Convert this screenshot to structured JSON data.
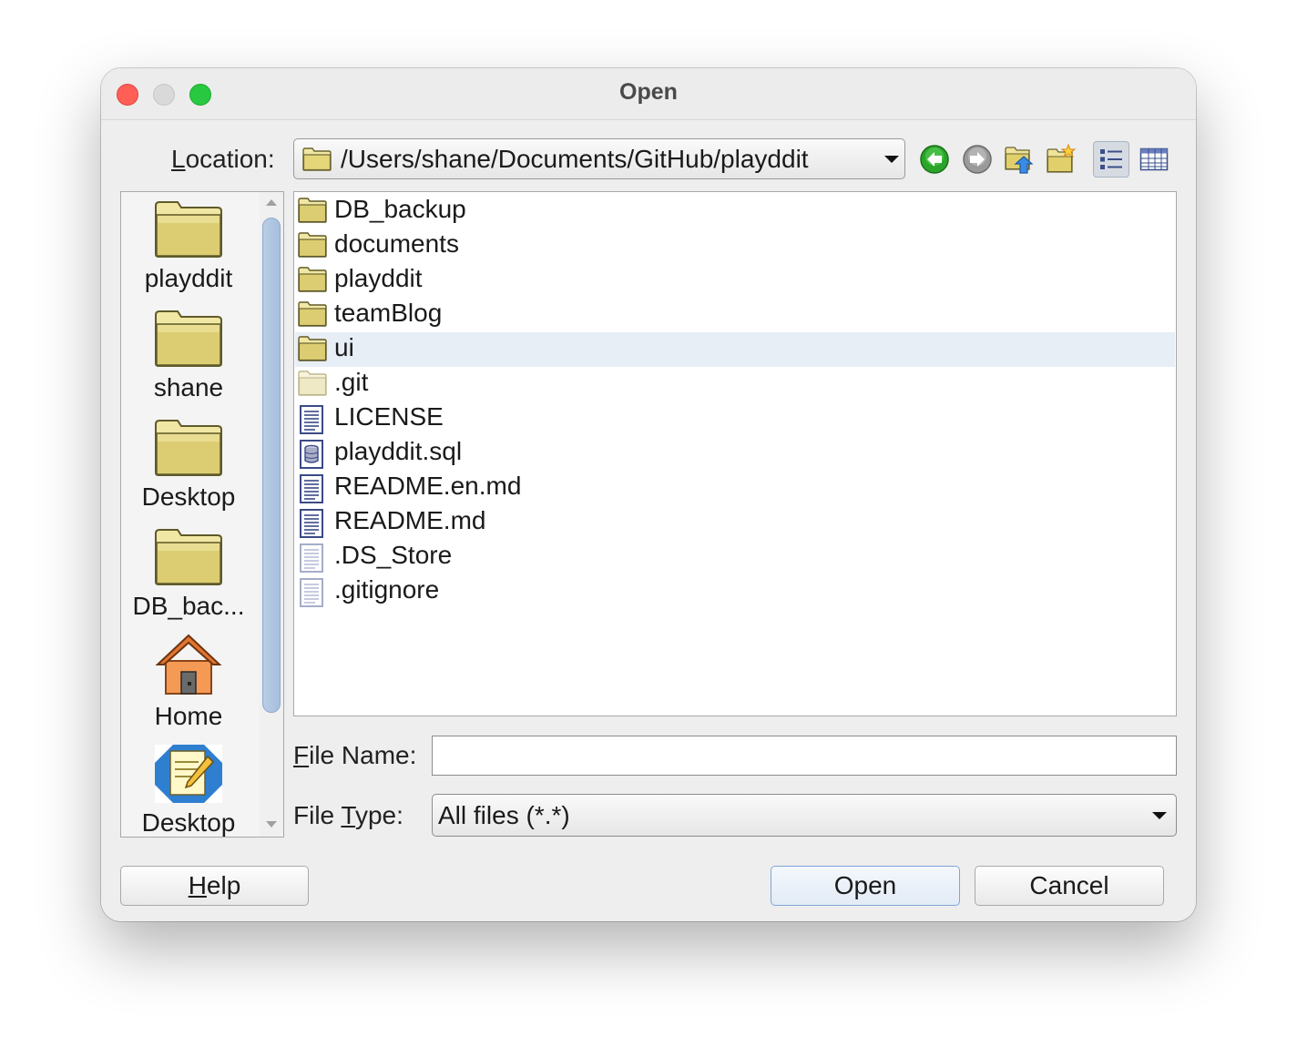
{
  "window": {
    "title": "Open"
  },
  "location": {
    "label_first": "L",
    "label_rest": "ocation:",
    "path": "/Users/shane/Documents/GitHub/playddit"
  },
  "toolbar": [
    {
      "icon": "back-arrow-icon"
    },
    {
      "icon": "forward-arrow-icon"
    },
    {
      "icon": "up-one-level-icon"
    },
    {
      "icon": "new-folder-icon"
    },
    {
      "icon": "list-view-icon",
      "selected": true
    },
    {
      "icon": "details-view-icon"
    }
  ],
  "places": {
    "items": [
      {
        "label": "playddit",
        "icon": "folder-icon"
      },
      {
        "label": "shane",
        "icon": "folder-icon"
      },
      {
        "label": "Desktop",
        "icon": "folder-icon"
      },
      {
        "label": "DB_bac...",
        "icon": "folder-icon"
      },
      {
        "label": "Home",
        "icon": "home-icon"
      },
      {
        "label": "Desktop",
        "icon": "notes-icon"
      }
    ]
  },
  "files": {
    "items": [
      {
        "name": "DB_backup",
        "icon": "folder-icon"
      },
      {
        "name": "documents",
        "icon": "folder-icon"
      },
      {
        "name": "playddit",
        "icon": "folder-icon"
      },
      {
        "name": "teamBlog",
        "icon": "folder-icon"
      },
      {
        "name": "ui",
        "icon": "folder-icon",
        "highlight": true
      },
      {
        "name": ".git",
        "icon": "hidden-folder-icon"
      },
      {
        "name": "LICENSE",
        "icon": "document-icon"
      },
      {
        "name": "playddit.sql",
        "icon": "database-file-icon"
      },
      {
        "name": "README.en.md",
        "icon": "document-icon"
      },
      {
        "name": "README.md",
        "icon": "document-icon"
      },
      {
        "name": ".DS_Store",
        "icon": "hidden-document-icon"
      },
      {
        "name": ".gitignore",
        "icon": "hidden-document-icon"
      }
    ]
  },
  "file_name": {
    "label_first": "F",
    "label_rest": "ile Name:",
    "value": ""
  },
  "file_type": {
    "label_pre": "File ",
    "label_mn": "T",
    "label_rest": "ype:",
    "selected": "All files (*.*)"
  },
  "buttons": {
    "help_mn": "H",
    "help_rest": "elp",
    "open": "Open",
    "cancel": "Cancel"
  }
}
